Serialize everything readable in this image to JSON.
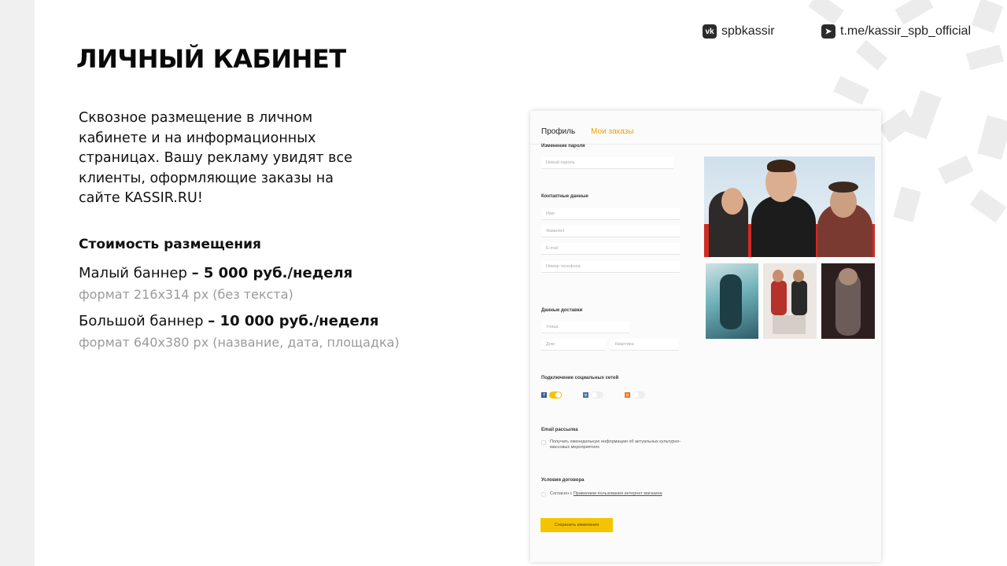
{
  "header": {
    "title": "ЛИЧНЫЙ КАБИНЕТ",
    "vk_label": "spbkassir",
    "telegram_label": "t.me/kassir_spb_official"
  },
  "description": {
    "lines": [
      "Сквозное  размещение в личном",
      "кабинете и на информационных",
      "страницах.  Вашу рекламу  увидят все",
      "клиенты, оформляющие заказы  на",
      "сайте  KASSIR.RU!"
    ]
  },
  "pricing": {
    "heading": "Стоимость размещения",
    "small_label": "Малый баннер ",
    "small_price": "– 5 000 руб./неделя",
    "small_format": "формат 216x314 px (без текста)",
    "large_label": "Большой баннер ",
    "large_price": "– 10 000 руб./неделя",
    "large_format": "формат 640x380 px (название,  дата,  площадка)"
  },
  "mockup": {
    "tab_profile": "Профиль",
    "tab_orders": "Мои заказы",
    "password_heading": "Изменение пароля",
    "new_password_placeholder": "Новый пароль",
    "contacts_heading": "Контактные данные",
    "name_placeholder": "Имя",
    "surname_placeholder": "Фамилия",
    "email_placeholder": "E-mail",
    "phone_placeholder": "Номер телефона",
    "delivery_heading": "Данные доставки",
    "street_placeholder": "Улица",
    "house_placeholder": "Дом",
    "apartment_placeholder": "Квартира",
    "social_heading": "Подключение социальных сетей",
    "email_heading": "Email рассылка",
    "email_text_1": "Получать еженедельную информацию об актуальных культурно-",
    "email_text_2": "массовых мероприятиях",
    "terms_heading": "Условия договора",
    "terms_prefix": "Согласен с ",
    "terms_link": "Правилами пользования интернет магазина",
    "save_button": "Сохранить изменения"
  },
  "colors": {
    "accent": "#f5c400",
    "tab_active": "#f2a100",
    "muted_text": "#9a9a9a"
  }
}
